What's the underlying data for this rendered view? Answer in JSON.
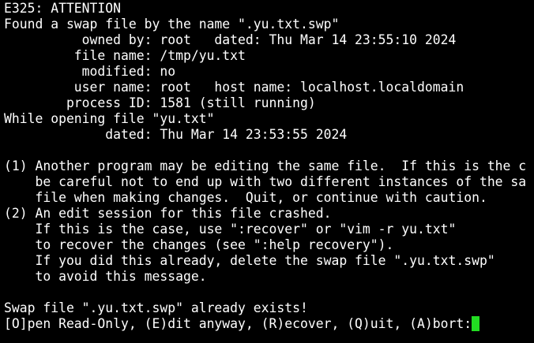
{
  "terminal": {
    "lines": [
      "E325: ATTENTION",
      "Found a swap file by the name \".yu.txt.swp\"",
      "          owned by: root   dated: Thu Mar 14 23:55:10 2024",
      "         file name: /tmp/yu.txt",
      "          modified: no",
      "         user name: root   host name: localhost.localdomain",
      "        process ID: 1581 (still running)",
      "While opening file \"yu.txt\"",
      "             dated: Thu Mar 14 23:53:55 2024",
      "",
      "(1) Another program may be editing the same file.  If this is the c",
      "    be careful not to end up with two different instances of the sa",
      "    file when making changes.  Quit, or continue with caution.",
      "(2) An edit session for this file crashed.",
      "    If this is the case, use \":recover\" or \"vim -r yu.txt\"",
      "    to recover the changes (see \":help recovery\").",
      "    If you did this already, delete the swap file \".yu.txt.swp\"",
      "    to avoid this message.",
      "",
      "Swap file \".yu.txt.swp\" already exists!"
    ],
    "prompt": "[O]pen Read-Only, (E)dit anyway, (R)ecover, (Q)uit, (A)bort:",
    "colors": {
      "background": "#000000",
      "text": "#ffffff",
      "cursor": "#22dd22"
    }
  }
}
